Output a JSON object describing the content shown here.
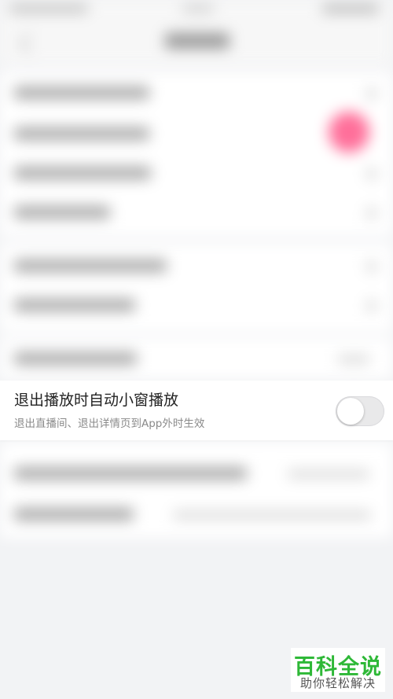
{
  "setting_row": {
    "title": "退出播放时自动小窗播放",
    "subtitle": "退出直播间、退出详情页到App外时生效",
    "enabled": false
  },
  "watermark": {
    "main": "百科全说",
    "sub": "助你轻松解决"
  },
  "colors": {
    "background": "#f2f3f5",
    "card": "#ffffff",
    "title_text": "#222222",
    "subtitle_text": "#8a8a8a",
    "toggle_off": "#e9e9ea",
    "watermark_green": "#2eb837",
    "blurred_accent": "#ff6f9a"
  }
}
